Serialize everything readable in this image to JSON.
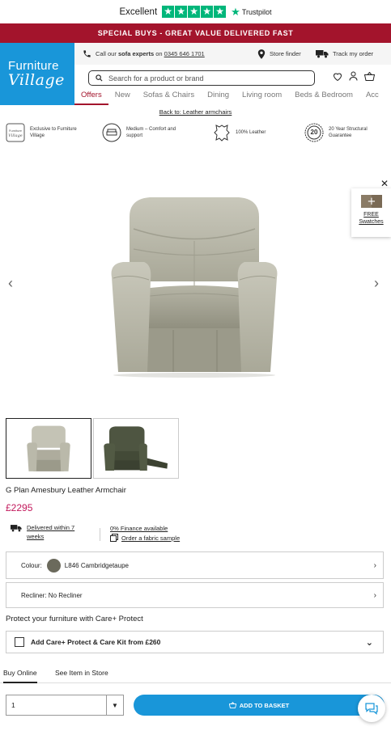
{
  "trustpilot": {
    "rating_word": "Excellent",
    "stars": 5,
    "brand": "Trustpilot"
  },
  "promo": {
    "text": "SPECIAL BUYS - GREAT VALUE DELIVERED FAST"
  },
  "logo": {
    "line1": "Furniture",
    "line2": "Village"
  },
  "header": {
    "call_prefix": "Call our",
    "call_bold": "sofa experts",
    "call_on": "on",
    "phone": "0345 646 1701",
    "store_finder": "Store finder",
    "track_order": "Track my order",
    "search_placeholder": "Search for a product or brand"
  },
  "nav": {
    "items": [
      "Offers",
      "New",
      "Sofas & Chairs",
      "Dining",
      "Living room",
      "Beds & Bedroom",
      "Acc"
    ],
    "active": "Offers"
  },
  "breadcrumb": {
    "back": "Back to: Leather armchairs"
  },
  "features": [
    {
      "icon": "fv-exclusive-icon",
      "text1": "Exclusive to Furniture",
      "text2": "Village"
    },
    {
      "icon": "comfort-icon",
      "text1": "Medium – Comfort and",
      "text2": "support"
    },
    {
      "icon": "leather-icon",
      "text1": "100% Leather",
      "text2": ""
    },
    {
      "icon": "guarantee-icon",
      "badge": "20",
      "text1": "20 Year Structural",
      "text2": "Guarantee"
    }
  ],
  "swatches": {
    "line1": "FREE",
    "line2": "Swatches"
  },
  "product": {
    "name": "G Plan Amesbury Leather Armchair",
    "price": "£2295",
    "delivery1": "Delivered within 7",
    "delivery2": "weeks",
    "finance": "0% Finance available",
    "sample": "Order a fabric sample"
  },
  "options": {
    "colour_label": "Colour:",
    "colour_value": "L846 Cambridgetaupe",
    "recliner": "Recliner: No Recliner"
  },
  "care": {
    "title": "Protect your furniture with Care+ Protect",
    "option": "Add Care+ Protect & Care Kit from £260"
  },
  "tabs": {
    "buy_online": "Buy Online",
    "see_in_store": "See Item in Store"
  },
  "purchase": {
    "qty": "1",
    "add_button": "ADD TO BASKET"
  },
  "colors": {
    "brand_blue": "#1996d9",
    "promo_red": "#a3142c",
    "price": "#c2185b",
    "trustpilot_green": "#00b67a"
  }
}
